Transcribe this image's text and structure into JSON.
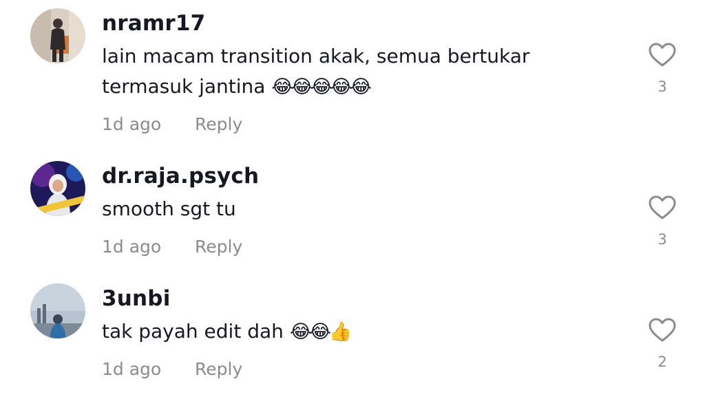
{
  "comments": [
    {
      "username": "nramr17",
      "text": "lain macam transition akak, semua bertukar termasuk jantina",
      "emojis": "😂😂😂😂😂",
      "time": "1d ago",
      "reply_label": "Reply",
      "likes": "3"
    },
    {
      "username": "dr.raja.psych",
      "text": "smooth sgt tu",
      "emojis": "",
      "time": "1d ago",
      "reply_label": "Reply",
      "likes": "3"
    },
    {
      "username": "3unbi",
      "text": "tak payah edit dah",
      "emojis": "😂😂👍",
      "time": "1d ago",
      "reply_label": "Reply",
      "likes": "2"
    }
  ],
  "colors": {
    "username": "#161823",
    "secondary": "#8a8b91",
    "icon": "#8a8b91"
  },
  "icons": {
    "like": "heart-outline-icon"
  }
}
